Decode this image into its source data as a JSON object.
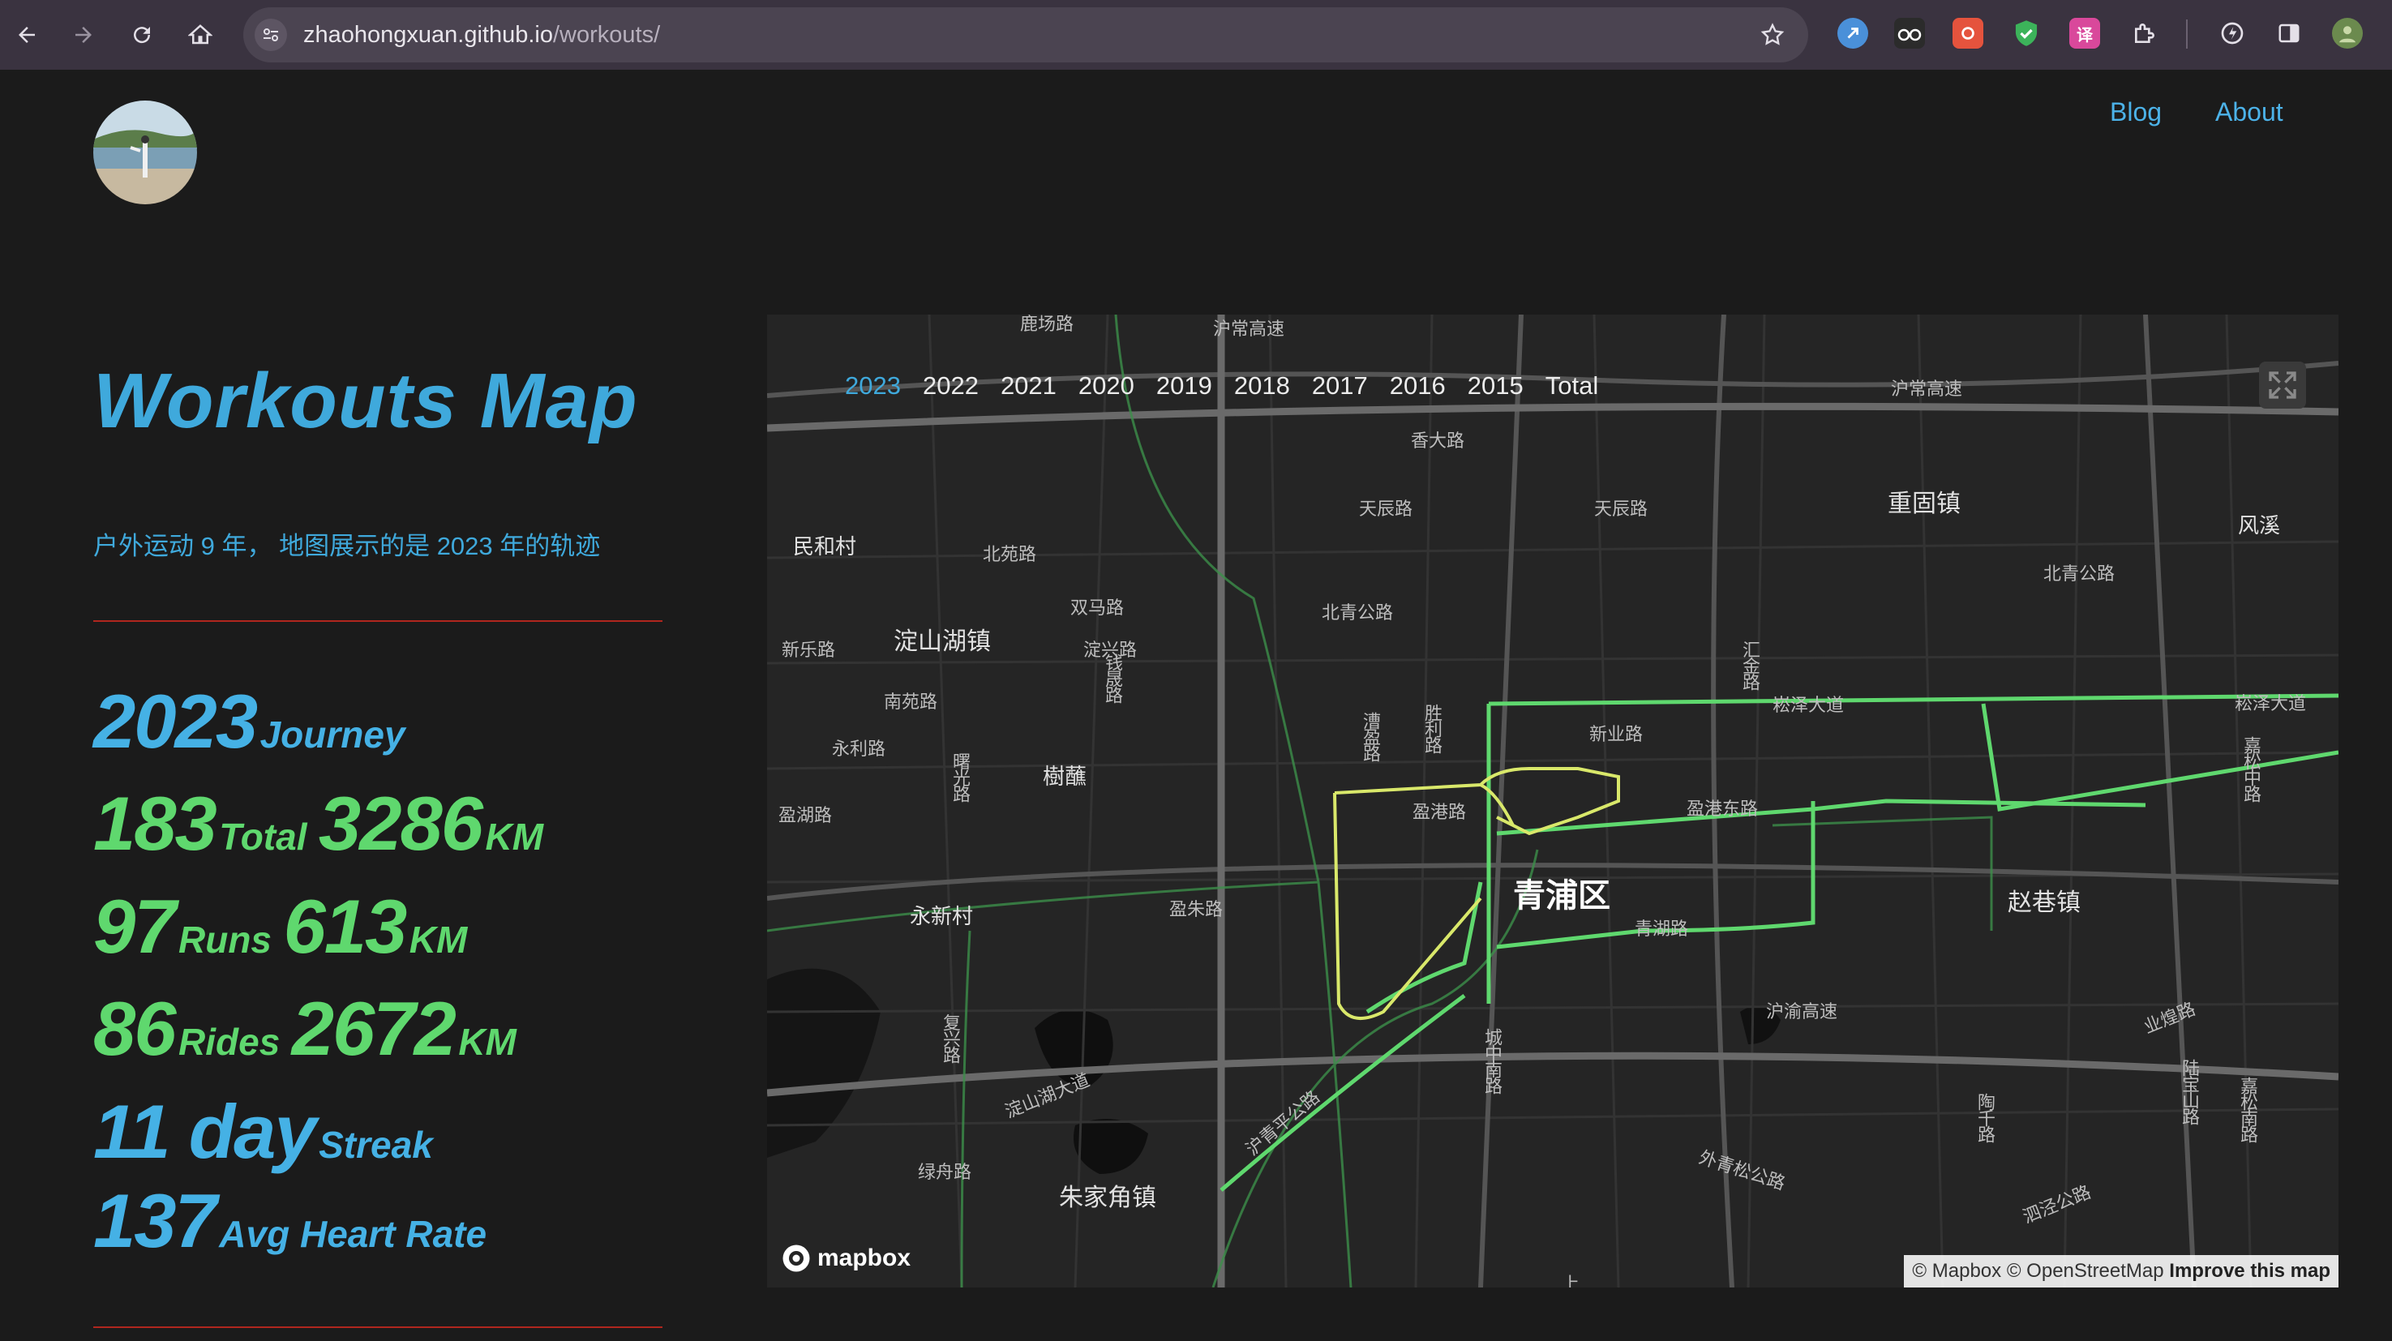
{
  "browser": {
    "url_host": "zhaohongxuan.github.io",
    "url_path": "/workouts/"
  },
  "nav": {
    "blog": "Blog",
    "about": "About"
  },
  "page": {
    "title": "Workouts Map",
    "subtitle": "户外运动 9 年， 地图展示的是 2023 年的轨迹"
  },
  "stats": {
    "journey_year": "2023",
    "journey_label": "Journey",
    "total_count": "183",
    "total_label": "Total",
    "total_km": "3286",
    "km_unit": "KM",
    "runs_count": "97",
    "runs_label": "Runs",
    "runs_km": "613",
    "rides_count": "86",
    "rides_label": "Rides",
    "rides_km": "2672",
    "streak_value": "11 day",
    "streak_label": "Streak",
    "avg_hr_value": "137",
    "avg_hr_label": "Avg Heart Rate"
  },
  "map": {
    "years": [
      "2023",
      "2022",
      "2021",
      "2020",
      "2019",
      "2018",
      "2017",
      "2016",
      "2015",
      "Total"
    ],
    "selected_year": "2023",
    "places": {
      "qingpu": "青浦区",
      "chonggu": "重固镇",
      "dianshanhu": "淀山湖镇",
      "zhujiajiao": "朱家角镇",
      "zhaoxiang": "赵巷镇",
      "minhecun": "民和村",
      "shuxiang": "樹蘸",
      "yongxincun": "永新村",
      "fengxi": "风溪"
    },
    "roads": {
      "luchang": "鹿场路",
      "huchang_gaosu_top": "沪常高速",
      "huchang_gaosu_right": "沪常高速",
      "xiangda": "香大路",
      "tianchen1": "天辰路",
      "tianchen2": "天辰路",
      "beiyuan": "北苑路",
      "shuangma": "双马路",
      "dianxing": "淀兴路",
      "beiqing1": "北青公路",
      "beiqing2": "北青公路",
      "xinle": "新乐路",
      "nanyuan": "南苑路",
      "yongli": "永利路",
      "yinghu": "盈湖路",
      "qiansheng": "钱晟路",
      "shuguang": "曙光路",
      "caoying": "漕盈路",
      "shengli": "胜利路",
      "huijin": "汇金路",
      "songze": "崧泽大道",
      "songze2": "崧泽大道",
      "xinye": "新业路",
      "yinggang": "盈港路",
      "yinggangdong": "盈港东路",
      "jiasongzhong": "嘉松中路",
      "yingzhu": "盈朱路",
      "qinghu": "青湖路",
      "huyu": "沪渝高速",
      "fuxing": "复兴路",
      "dianshanhu_dadao": "淀山湖大道",
      "huqingping": "沪青平公路",
      "chengzhongnan": "城中南路",
      "lvzhou": "绿舟路",
      "taoqian": "陶千路",
      "waiqingsong": "外青松公路",
      "lubao": "陆宝山路",
      "jiasongnan": "嘉松南路",
      "yehuang": "业煌路",
      "sijing": "泗泾公路",
      "shang": "上"
    },
    "logo_text": "mapbox",
    "attribution": "© Mapbox © OpenStreetMap",
    "improve": "Improve this map",
    "track_color": "#5fd86e",
    "highlight_color": "#d9e86a"
  }
}
